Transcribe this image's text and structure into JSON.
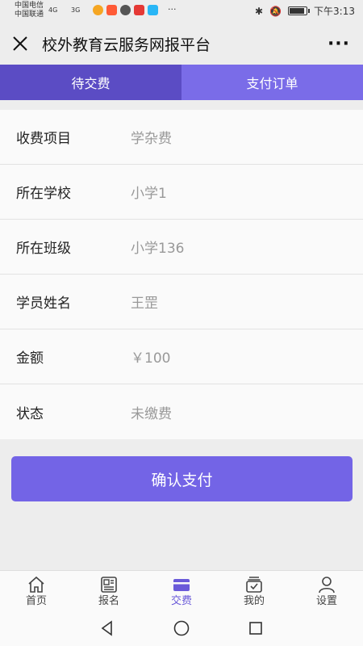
{
  "status_bar": {
    "carrier1": "中国电信",
    "carrier2": "中国联通",
    "sig1": "4G",
    "sig2": "3G",
    "more": "···",
    "time": "下午3:13"
  },
  "header": {
    "title": "校外教育云服务网报平台",
    "menu": "···"
  },
  "tabs": [
    {
      "label": "待交费",
      "active": true
    },
    {
      "label": "支付订单",
      "active": false
    }
  ],
  "form": {
    "rows": [
      {
        "label": "收费项目",
        "value": "学杂费"
      },
      {
        "label": "所在学校",
        "value": "小学1"
      },
      {
        "label": "所在班级",
        "value": "小学136"
      },
      {
        "label": "学员姓名",
        "value": "王罡"
      },
      {
        "label": "金额",
        "value": "￥100"
      },
      {
        "label": "状态",
        "value": "未缴费"
      }
    ]
  },
  "confirm_button": "确认支付",
  "bottom_nav": [
    {
      "label": "首页",
      "icon": "home-icon"
    },
    {
      "label": "报名",
      "icon": "signup-icon"
    },
    {
      "label": "交费",
      "icon": "payment-card-icon",
      "active": true
    },
    {
      "label": "我的",
      "icon": "my-inbox-icon"
    },
    {
      "label": "设置",
      "icon": "user-settings-icon"
    }
  ],
  "colors": {
    "accent": "#7364e6",
    "tab_active": "#5b4cc4",
    "tab_inactive": "#7a6ce8"
  }
}
